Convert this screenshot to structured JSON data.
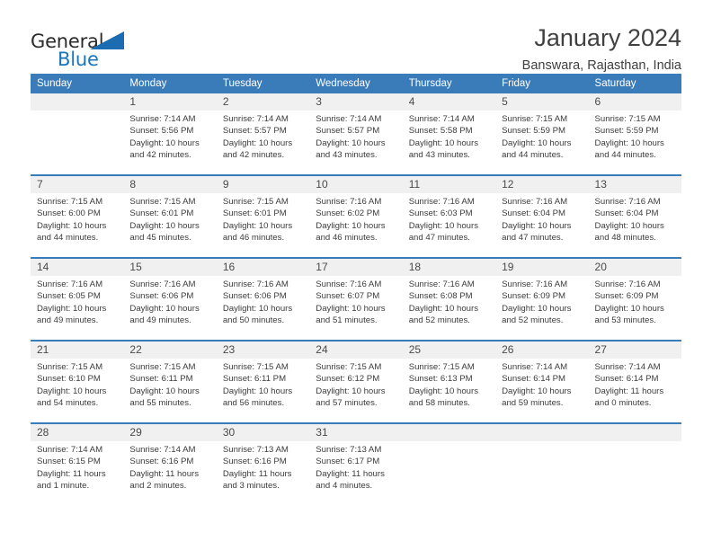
{
  "brand": {
    "name_part1": "General",
    "name_part2": "Blue",
    "triangle_color": "#1b6cb0",
    "blue_color": "#1b75bb"
  },
  "header": {
    "title": "January 2024",
    "subtitle": "Banswara, Rajasthan, India",
    "accent_color": "#3a7cba",
    "day_band_color": "#f0f0f0"
  },
  "weekdays": [
    "Sunday",
    "Monday",
    "Tuesday",
    "Wednesday",
    "Thursday",
    "Friday",
    "Saturday"
  ],
  "weeks": [
    [
      {
        "day": "",
        "sunrise": "",
        "sunset": "",
        "daylight": "",
        "empty": true
      },
      {
        "day": "1",
        "sunrise": "Sunrise: 7:14 AM",
        "sunset": "Sunset: 5:56 PM",
        "daylight": "Daylight: 10 hours and 42 minutes."
      },
      {
        "day": "2",
        "sunrise": "Sunrise: 7:14 AM",
        "sunset": "Sunset: 5:57 PM",
        "daylight": "Daylight: 10 hours and 42 minutes."
      },
      {
        "day": "3",
        "sunrise": "Sunrise: 7:14 AM",
        "sunset": "Sunset: 5:57 PM",
        "daylight": "Daylight: 10 hours and 43 minutes."
      },
      {
        "day": "4",
        "sunrise": "Sunrise: 7:14 AM",
        "sunset": "Sunset: 5:58 PM",
        "daylight": "Daylight: 10 hours and 43 minutes."
      },
      {
        "day": "5",
        "sunrise": "Sunrise: 7:15 AM",
        "sunset": "Sunset: 5:59 PM",
        "daylight": "Daylight: 10 hours and 44 minutes."
      },
      {
        "day": "6",
        "sunrise": "Sunrise: 7:15 AM",
        "sunset": "Sunset: 5:59 PM",
        "daylight": "Daylight: 10 hours and 44 minutes."
      }
    ],
    [
      {
        "day": "7",
        "sunrise": "Sunrise: 7:15 AM",
        "sunset": "Sunset: 6:00 PM",
        "daylight": "Daylight: 10 hours and 44 minutes."
      },
      {
        "day": "8",
        "sunrise": "Sunrise: 7:15 AM",
        "sunset": "Sunset: 6:01 PM",
        "daylight": "Daylight: 10 hours and 45 minutes."
      },
      {
        "day": "9",
        "sunrise": "Sunrise: 7:15 AM",
        "sunset": "Sunset: 6:01 PM",
        "daylight": "Daylight: 10 hours and 46 minutes."
      },
      {
        "day": "10",
        "sunrise": "Sunrise: 7:16 AM",
        "sunset": "Sunset: 6:02 PM",
        "daylight": "Daylight: 10 hours and 46 minutes."
      },
      {
        "day": "11",
        "sunrise": "Sunrise: 7:16 AM",
        "sunset": "Sunset: 6:03 PM",
        "daylight": "Daylight: 10 hours and 47 minutes."
      },
      {
        "day": "12",
        "sunrise": "Sunrise: 7:16 AM",
        "sunset": "Sunset: 6:04 PM",
        "daylight": "Daylight: 10 hours and 47 minutes."
      },
      {
        "day": "13",
        "sunrise": "Sunrise: 7:16 AM",
        "sunset": "Sunset: 6:04 PM",
        "daylight": "Daylight: 10 hours and 48 minutes."
      }
    ],
    [
      {
        "day": "14",
        "sunrise": "Sunrise: 7:16 AM",
        "sunset": "Sunset: 6:05 PM",
        "daylight": "Daylight: 10 hours and 49 minutes."
      },
      {
        "day": "15",
        "sunrise": "Sunrise: 7:16 AM",
        "sunset": "Sunset: 6:06 PM",
        "daylight": "Daylight: 10 hours and 49 minutes."
      },
      {
        "day": "16",
        "sunrise": "Sunrise: 7:16 AM",
        "sunset": "Sunset: 6:06 PM",
        "daylight": "Daylight: 10 hours and 50 minutes."
      },
      {
        "day": "17",
        "sunrise": "Sunrise: 7:16 AM",
        "sunset": "Sunset: 6:07 PM",
        "daylight": "Daylight: 10 hours and 51 minutes."
      },
      {
        "day": "18",
        "sunrise": "Sunrise: 7:16 AM",
        "sunset": "Sunset: 6:08 PM",
        "daylight": "Daylight: 10 hours and 52 minutes."
      },
      {
        "day": "19",
        "sunrise": "Sunrise: 7:16 AM",
        "sunset": "Sunset: 6:09 PM",
        "daylight": "Daylight: 10 hours and 52 minutes."
      },
      {
        "day": "20",
        "sunrise": "Sunrise: 7:16 AM",
        "sunset": "Sunset: 6:09 PM",
        "daylight": "Daylight: 10 hours and 53 minutes."
      }
    ],
    [
      {
        "day": "21",
        "sunrise": "Sunrise: 7:15 AM",
        "sunset": "Sunset: 6:10 PM",
        "daylight": "Daylight: 10 hours and 54 minutes."
      },
      {
        "day": "22",
        "sunrise": "Sunrise: 7:15 AM",
        "sunset": "Sunset: 6:11 PM",
        "daylight": "Daylight: 10 hours and 55 minutes."
      },
      {
        "day": "23",
        "sunrise": "Sunrise: 7:15 AM",
        "sunset": "Sunset: 6:11 PM",
        "daylight": "Daylight: 10 hours and 56 minutes."
      },
      {
        "day": "24",
        "sunrise": "Sunrise: 7:15 AM",
        "sunset": "Sunset: 6:12 PM",
        "daylight": "Daylight: 10 hours and 57 minutes."
      },
      {
        "day": "25",
        "sunrise": "Sunrise: 7:15 AM",
        "sunset": "Sunset: 6:13 PM",
        "daylight": "Daylight: 10 hours and 58 minutes."
      },
      {
        "day": "26",
        "sunrise": "Sunrise: 7:14 AM",
        "sunset": "Sunset: 6:14 PM",
        "daylight": "Daylight: 10 hours and 59 minutes."
      },
      {
        "day": "27",
        "sunrise": "Sunrise: 7:14 AM",
        "sunset": "Sunset: 6:14 PM",
        "daylight": "Daylight: 11 hours and 0 minutes."
      }
    ],
    [
      {
        "day": "28",
        "sunrise": "Sunrise: 7:14 AM",
        "sunset": "Sunset: 6:15 PM",
        "daylight": "Daylight: 11 hours and 1 minute."
      },
      {
        "day": "29",
        "sunrise": "Sunrise: 7:14 AM",
        "sunset": "Sunset: 6:16 PM",
        "daylight": "Daylight: 11 hours and 2 minutes."
      },
      {
        "day": "30",
        "sunrise": "Sunrise: 7:13 AM",
        "sunset": "Sunset: 6:16 PM",
        "daylight": "Daylight: 11 hours and 3 minutes."
      },
      {
        "day": "31",
        "sunrise": "Sunrise: 7:13 AM",
        "sunset": "Sunset: 6:17 PM",
        "daylight": "Daylight: 11 hours and 4 minutes."
      },
      {
        "day": "",
        "sunrise": "",
        "sunset": "",
        "daylight": "",
        "empty": true
      },
      {
        "day": "",
        "sunrise": "",
        "sunset": "",
        "daylight": "",
        "empty": true
      },
      {
        "day": "",
        "sunrise": "",
        "sunset": "",
        "daylight": "",
        "empty": true
      }
    ]
  ]
}
